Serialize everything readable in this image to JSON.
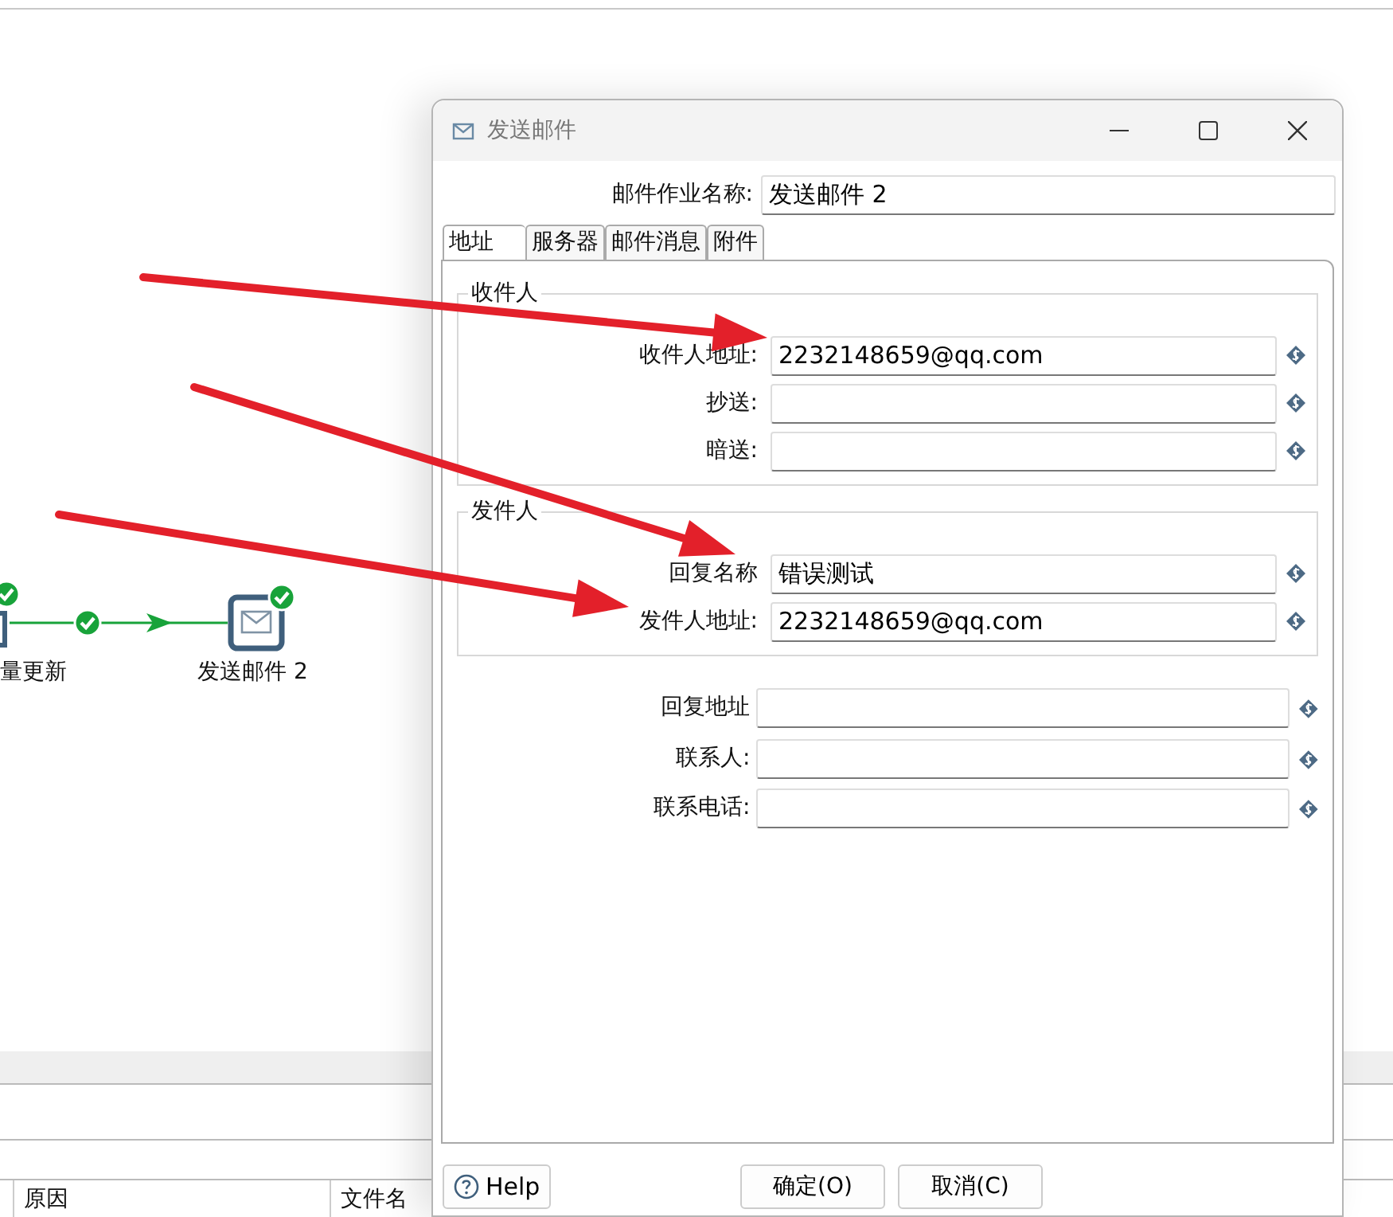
{
  "canvas": {
    "nodes": [
      {
        "label": "量更新",
        "kind": "partial",
        "ok": true
      },
      {
        "label": "发送邮件 2",
        "kind": "mail",
        "ok": true
      }
    ],
    "edges": [
      {
        "ok": true
      }
    ]
  },
  "log_table": {
    "columns": [
      "原因",
      "文件名"
    ]
  },
  "dialog": {
    "title": "发送邮件",
    "job_name": {
      "label": "邮件作业名称:",
      "value": "发送邮件 2"
    },
    "tabs": [
      {
        "label": "地址",
        "selected": true
      },
      {
        "label": "服务器",
        "selected": false
      },
      {
        "label": "邮件消息",
        "selected": false
      },
      {
        "label": "附件",
        "selected": false
      }
    ],
    "groups": [
      {
        "title": "收件人",
        "fields": [
          {
            "label": "收件人地址:",
            "value": "2232148659@qq.com"
          },
          {
            "label": "抄送:"
          },
          {
            "label": "暗送:"
          }
        ]
      },
      {
        "title": "发件人",
        "fields": [
          {
            "label": "回复名称",
            "value": "错误测试"
          },
          {
            "label": "发件人地址:",
            "value": "2232148659@qq.com"
          }
        ]
      }
    ],
    "fields": [
      {
        "label": "回复地址"
      },
      {
        "label": "联系人:"
      },
      {
        "label": "联系电话:"
      }
    ],
    "help": "Help",
    "buttons": [
      {
        "label": "确定(O)"
      },
      {
        "label": "取消(C)"
      }
    ]
  }
}
